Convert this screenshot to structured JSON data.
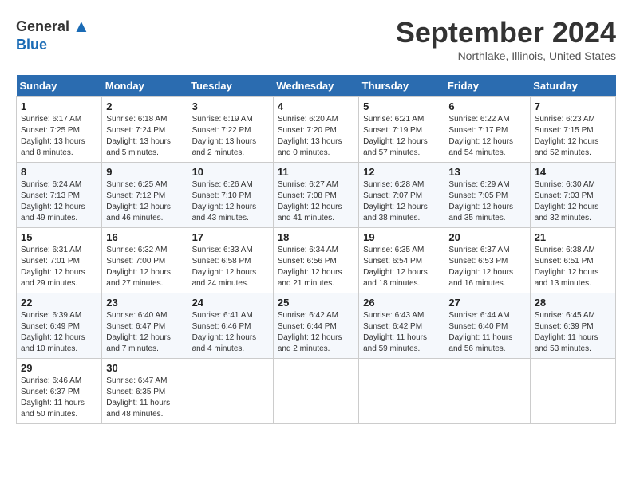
{
  "logo": {
    "general": "General",
    "blue": "Blue"
  },
  "title": "September 2024",
  "location": "Northlake, Illinois, United States",
  "headers": [
    "Sunday",
    "Monday",
    "Tuesday",
    "Wednesday",
    "Thursday",
    "Friday",
    "Saturday"
  ],
  "weeks": [
    [
      {
        "day": "1",
        "info": "Sunrise: 6:17 AM\nSunset: 7:25 PM\nDaylight: 13 hours\nand 8 minutes."
      },
      {
        "day": "2",
        "info": "Sunrise: 6:18 AM\nSunset: 7:24 PM\nDaylight: 13 hours\nand 5 minutes."
      },
      {
        "day": "3",
        "info": "Sunrise: 6:19 AM\nSunset: 7:22 PM\nDaylight: 13 hours\nand 2 minutes."
      },
      {
        "day": "4",
        "info": "Sunrise: 6:20 AM\nSunset: 7:20 PM\nDaylight: 13 hours\nand 0 minutes."
      },
      {
        "day": "5",
        "info": "Sunrise: 6:21 AM\nSunset: 7:19 PM\nDaylight: 12 hours\nand 57 minutes."
      },
      {
        "day": "6",
        "info": "Sunrise: 6:22 AM\nSunset: 7:17 PM\nDaylight: 12 hours\nand 54 minutes."
      },
      {
        "day": "7",
        "info": "Sunrise: 6:23 AM\nSunset: 7:15 PM\nDaylight: 12 hours\nand 52 minutes."
      }
    ],
    [
      {
        "day": "8",
        "info": "Sunrise: 6:24 AM\nSunset: 7:13 PM\nDaylight: 12 hours\nand 49 minutes."
      },
      {
        "day": "9",
        "info": "Sunrise: 6:25 AM\nSunset: 7:12 PM\nDaylight: 12 hours\nand 46 minutes."
      },
      {
        "day": "10",
        "info": "Sunrise: 6:26 AM\nSunset: 7:10 PM\nDaylight: 12 hours\nand 43 minutes."
      },
      {
        "day": "11",
        "info": "Sunrise: 6:27 AM\nSunset: 7:08 PM\nDaylight: 12 hours\nand 41 minutes."
      },
      {
        "day": "12",
        "info": "Sunrise: 6:28 AM\nSunset: 7:07 PM\nDaylight: 12 hours\nand 38 minutes."
      },
      {
        "day": "13",
        "info": "Sunrise: 6:29 AM\nSunset: 7:05 PM\nDaylight: 12 hours\nand 35 minutes."
      },
      {
        "day": "14",
        "info": "Sunrise: 6:30 AM\nSunset: 7:03 PM\nDaylight: 12 hours\nand 32 minutes."
      }
    ],
    [
      {
        "day": "15",
        "info": "Sunrise: 6:31 AM\nSunset: 7:01 PM\nDaylight: 12 hours\nand 29 minutes."
      },
      {
        "day": "16",
        "info": "Sunrise: 6:32 AM\nSunset: 7:00 PM\nDaylight: 12 hours\nand 27 minutes."
      },
      {
        "day": "17",
        "info": "Sunrise: 6:33 AM\nSunset: 6:58 PM\nDaylight: 12 hours\nand 24 minutes."
      },
      {
        "day": "18",
        "info": "Sunrise: 6:34 AM\nSunset: 6:56 PM\nDaylight: 12 hours\nand 21 minutes."
      },
      {
        "day": "19",
        "info": "Sunrise: 6:35 AM\nSunset: 6:54 PM\nDaylight: 12 hours\nand 18 minutes."
      },
      {
        "day": "20",
        "info": "Sunrise: 6:37 AM\nSunset: 6:53 PM\nDaylight: 12 hours\nand 16 minutes."
      },
      {
        "day": "21",
        "info": "Sunrise: 6:38 AM\nSunset: 6:51 PM\nDaylight: 12 hours\nand 13 minutes."
      }
    ],
    [
      {
        "day": "22",
        "info": "Sunrise: 6:39 AM\nSunset: 6:49 PM\nDaylight: 12 hours\nand 10 minutes."
      },
      {
        "day": "23",
        "info": "Sunrise: 6:40 AM\nSunset: 6:47 PM\nDaylight: 12 hours\nand 7 minutes."
      },
      {
        "day": "24",
        "info": "Sunrise: 6:41 AM\nSunset: 6:46 PM\nDaylight: 12 hours\nand 4 minutes."
      },
      {
        "day": "25",
        "info": "Sunrise: 6:42 AM\nSunset: 6:44 PM\nDaylight: 12 hours\nand 2 minutes."
      },
      {
        "day": "26",
        "info": "Sunrise: 6:43 AM\nSunset: 6:42 PM\nDaylight: 11 hours\nand 59 minutes."
      },
      {
        "day": "27",
        "info": "Sunrise: 6:44 AM\nSunset: 6:40 PM\nDaylight: 11 hours\nand 56 minutes."
      },
      {
        "day": "28",
        "info": "Sunrise: 6:45 AM\nSunset: 6:39 PM\nDaylight: 11 hours\nand 53 minutes."
      }
    ],
    [
      {
        "day": "29",
        "info": "Sunrise: 6:46 AM\nSunset: 6:37 PM\nDaylight: 11 hours\nand 50 minutes."
      },
      {
        "day": "30",
        "info": "Sunrise: 6:47 AM\nSunset: 6:35 PM\nDaylight: 11 hours\nand 48 minutes."
      },
      null,
      null,
      null,
      null,
      null
    ]
  ]
}
